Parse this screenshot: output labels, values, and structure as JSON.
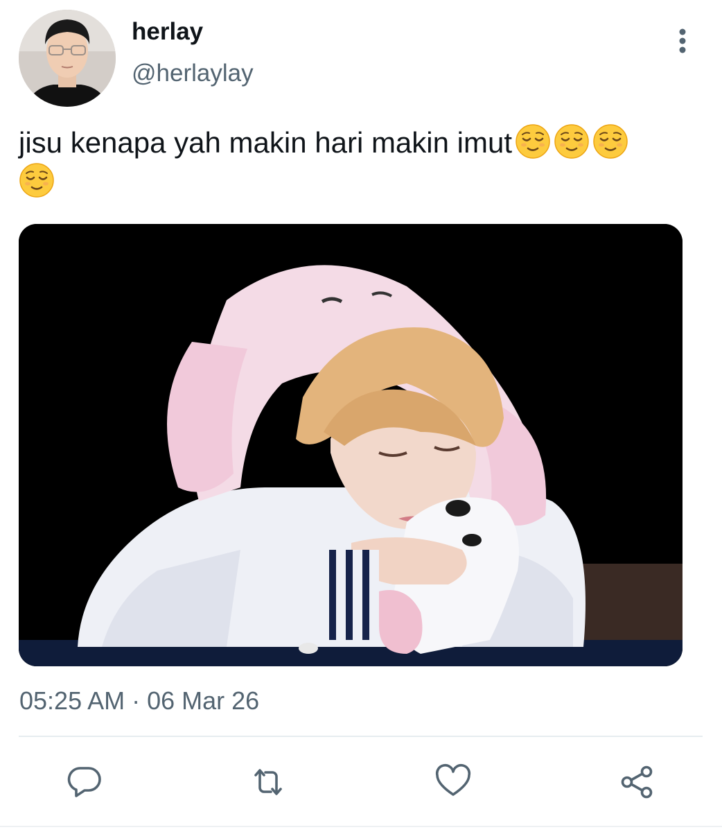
{
  "tweet": {
    "author": {
      "display_name": "herlay",
      "handle": "@herlaylay"
    },
    "text": "jisu kenapa yah makin hari makin imut",
    "emoji": [
      "relieved-face",
      "relieved-face",
      "relieved-face",
      "relieved-face"
    ],
    "timestamp": "05:25 AM · 06 Mar 26",
    "media": {
      "kind": "photo",
      "subject": "blonde person in white jacket and pink bunny hat resting head on a plush toy"
    }
  },
  "actions": [
    {
      "icon": "reply-icon"
    },
    {
      "icon": "retweet-icon"
    },
    {
      "icon": "like-icon"
    },
    {
      "icon": "share-icon"
    }
  ],
  "colors": {
    "text": "#0f1419",
    "secondary": "#536471",
    "icon": "#536471",
    "divider": "#e6ecf0"
  }
}
